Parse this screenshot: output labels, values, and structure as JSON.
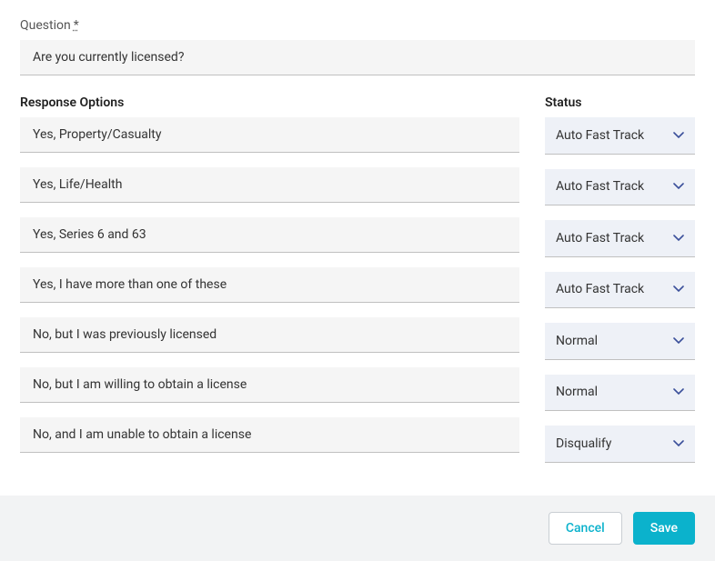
{
  "question": {
    "label": "Question",
    "required_marker": "*",
    "value": "Are you currently licensed?"
  },
  "headers": {
    "response": "Response Options",
    "status": "Status"
  },
  "rows": [
    {
      "response": "Yes, Property/Casualty",
      "status": "Auto Fast Track"
    },
    {
      "response": "Yes, Life/Health",
      "status": "Auto Fast Track"
    },
    {
      "response": "Yes, Series 6 and 63",
      "status": "Auto Fast Track"
    },
    {
      "response": "Yes, I have more than one of these",
      "status": "Auto Fast Track"
    },
    {
      "response": "No, but I was previously licensed",
      "status": "Normal"
    },
    {
      "response": "No, but I am willing to obtain a license",
      "status": "Normal"
    },
    {
      "response": "No, and I am unable to obtain a license",
      "status": "Disqualify"
    }
  ],
  "footer": {
    "cancel": "Cancel",
    "save": "Save"
  }
}
